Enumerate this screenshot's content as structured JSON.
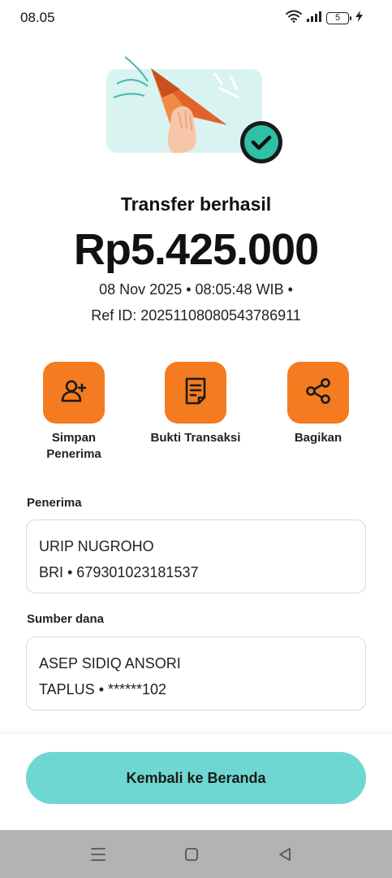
{
  "status_bar": {
    "time": "08.05",
    "battery_level": "5",
    "icons": [
      "wifi-icon",
      "signal-icon",
      "battery-icon",
      "charging-icon"
    ]
  },
  "colors": {
    "accent_orange": "#f47b20",
    "primary_button": "#6ed7d2",
    "success_green": "#2fc0a6"
  },
  "hero": {
    "illustration": "paper-plane-hand-illustration",
    "badge": "check-icon"
  },
  "result": {
    "title": "Transfer berhasil",
    "amount": "Rp5.425.000",
    "datetime": "08 Nov 2025 • 08:05:48 WIB •",
    "ref_id": "Ref ID: 20251108080543786911"
  },
  "actions": [
    {
      "label": "Simpan Penerima",
      "icon": "add-user-icon"
    },
    {
      "label": "Bukti Transaksi",
      "icon": "receipt-icon"
    },
    {
      "label": "Bagikan",
      "icon": "share-icon"
    }
  ],
  "recipient": {
    "section_label": "Penerima",
    "name": "URIP NUGROHO",
    "account": "BRI • 679301023181537"
  },
  "source": {
    "section_label": "Sumber dana",
    "name": "ASEP SIDIQ ANSORI",
    "account": "TAPLUS • ******102"
  },
  "footer": {
    "button_label": "Kembali ke Beranda"
  },
  "nav_bar": {
    "icons": [
      "menu-icon",
      "home-icon",
      "back-icon"
    ]
  }
}
